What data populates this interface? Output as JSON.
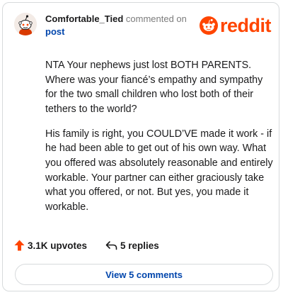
{
  "comment": {
    "username": "Comfortable_Tied",
    "action": " commented on ",
    "post_link": "post",
    "paragraphs": [
      "NTA Your nephews just lost BOTH PARENTS. Where was your fiancé’s empathy and sympathy for the two small children who lost both of their tethers to the world?",
      "His family is right, you COULD’VE made it work - if he had been able to get out of his own way. What you offered was absolutely reasonable and entirely workable. Your partner can either graciously take what you offered, or not. But yes, you made it workable."
    ],
    "upvotes": "3.1K upvotes",
    "replies": "5 replies",
    "view_comments": "View 5 comments"
  },
  "brand": {
    "wordmark": "reddit",
    "color": "#ff4500",
    "icon": "reddit-alien-icon"
  },
  "colors": {
    "link": "#0045ac",
    "upvote": "#ff4500",
    "text": "#1a1a1b",
    "muted": "#7c7c7c"
  }
}
